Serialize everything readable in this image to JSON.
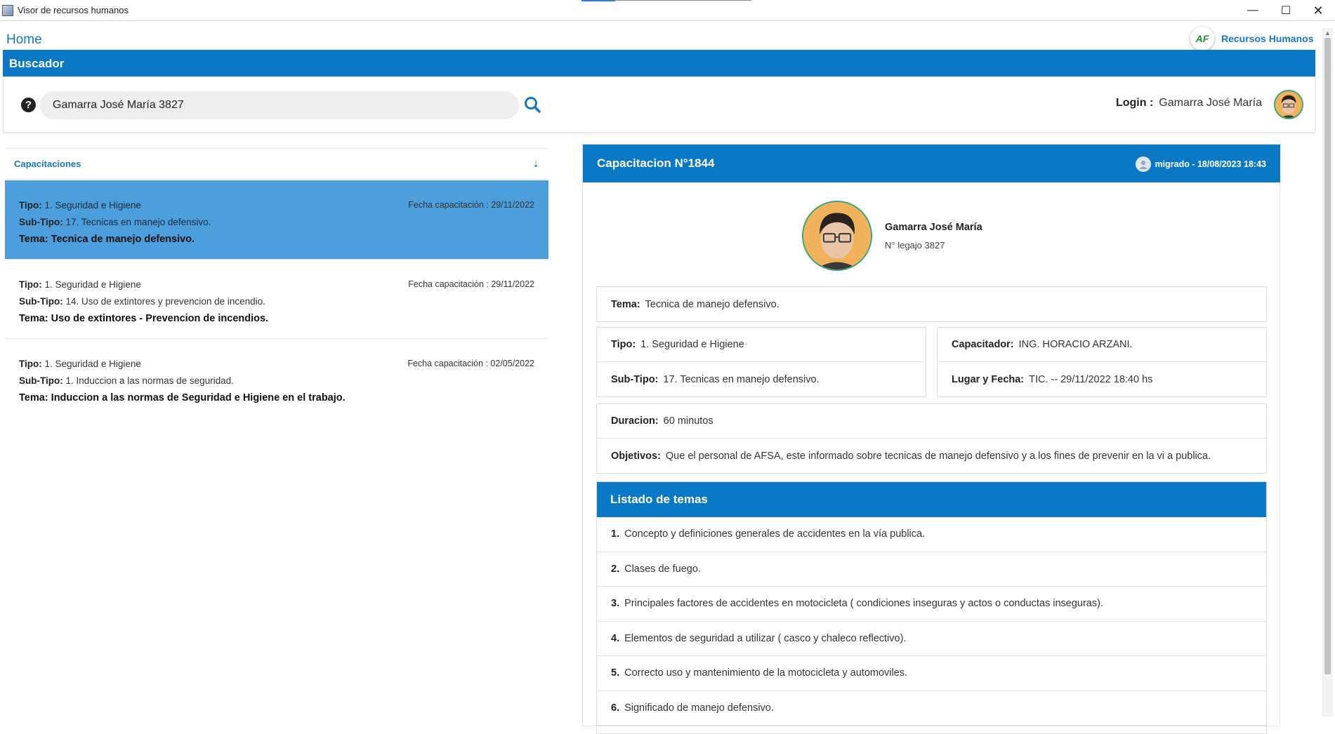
{
  "window": {
    "title": "Visor de recursos humanos",
    "min_label": "—",
    "max_label": "☐",
    "close_label": "✕"
  },
  "nav": {
    "home": "Home",
    "brand_logo": "AF",
    "brand_name": "Recursos Humanos"
  },
  "search": {
    "section_title": "Buscador",
    "help_glyph": "?",
    "value": "Gamarra José María 3827",
    "login_label": "Login :",
    "login_user": "Gamarra José María"
  },
  "list": {
    "header": "Capacitaciones",
    "sort_glyph": "⇣",
    "items": [
      {
        "tipo_label": "Tipo:",
        "tipo": "1. Seguridad e Higiene",
        "subtipo_label": "Sub-Tipo:",
        "subtipo": "17. Tecnicas en manejo defensivo.",
        "tema": "Tema: Tecnica de manejo defensivo.",
        "fecha": "Fecha capacitación : 29/11/2022"
      },
      {
        "tipo_label": "Tipo:",
        "tipo": "1. Seguridad e Higiene",
        "subtipo_label": "Sub-Tipo:",
        "subtipo": "14. Uso de extintores y prevencion de incendio.",
        "tema": "Tema: Uso de extintores - Prevencion de incendios.",
        "fecha": "Fecha capacitación : 29/11/2022"
      },
      {
        "tipo_label": "Tipo:",
        "tipo": "1. Seguridad e Higiene",
        "subtipo_label": "Sub-Tipo:",
        "subtipo": "1. Induccion a las normas de seguridad.",
        "tema": "Tema: Induccion a las normas de Seguridad e Higiene en el trabajo.",
        "fecha": "Fecha capacitación : 02/05/2022"
      }
    ]
  },
  "detail": {
    "title": "Capacitacion N°1844",
    "meta": "migrado - 18/08/2023 18:43",
    "person_name": "Gamarra José María",
    "legajo": "N° legajo 3827",
    "tema_label": "Tema:",
    "tema": "Tecnica de manejo defensivo.",
    "tipo_label": "Tipo:",
    "tipo": "1. Seguridad e Higiene",
    "subtipo_label": "Sub-Tipo:",
    "subtipo": "17. Tecnicas en manejo defensivo.",
    "capacitador_label": "Capacitador:",
    "capacitador": "ING. HORACIO ARZANI.",
    "lugar_label": "Lugar y Fecha:",
    "lugar": "TIC. -- 29/11/2022 18:40 hs",
    "duracion_label": "Duracion:",
    "duracion": "60 minutos",
    "objetivos_label": "Objetivos:",
    "objetivos": "Que el personal de AFSA, este informado sobre tecnicas de manejo defensivo y a los fines de prevenir en la vi a publica.",
    "temas_title": "Listado de temas",
    "temas": [
      {
        "num": "1.",
        "text": "Concepto y definiciones generales de accidentes en la vía publica."
      },
      {
        "num": "2.",
        "text": "Clases de fuego."
      },
      {
        "num": "3.",
        "text": "Principales factores de accidentes en motocicleta ( condiciones inseguras y actos o conductas inseguras)."
      },
      {
        "num": "4.",
        "text": "Elementos de seguridad a utilizar ( casco y chaleco reflectivo)."
      },
      {
        "num": "5.",
        "text": "Correcto uso y mantenimiento de la motocicleta y automoviles."
      },
      {
        "num": "6.",
        "text": "Significado de manejo defensivo."
      }
    ]
  },
  "colors": {
    "primary": "#0b78c5",
    "selected_row": "#4c9fdc",
    "link": "#1976c2",
    "avatar_ring": "#3aa57a"
  }
}
